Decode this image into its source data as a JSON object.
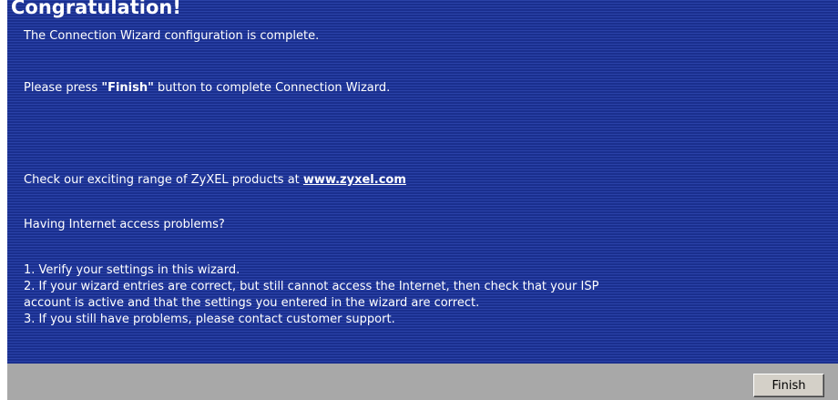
{
  "title": "Congratulation!",
  "messages": {
    "complete": "The Connection Wizard configuration is complete.",
    "press_prefix": "Please press ",
    "press_bold": "\"Finish\"",
    "press_suffix": " button to complete Connection Wizard.",
    "check_prefix": "Check our exciting range of ZyXEL products at ",
    "check_link": "www.zyxel.com",
    "problems": "Having Internet access problems?"
  },
  "steps": [
    "1. Verify your settings in this wizard.",
    "2. If your wizard entries are correct, but still cannot access the Internet, then check that your ISP",
    "account is active and that the settings you entered in the wizard are correct.",
    "3. If you still have problems, please contact customer support."
  ],
  "footer": {
    "finish_label": "Finish"
  },
  "colors": {
    "panel_blue": "#1e3597",
    "footer_gray": "#a8a8a8",
    "button_face": "#d4d0c8"
  }
}
